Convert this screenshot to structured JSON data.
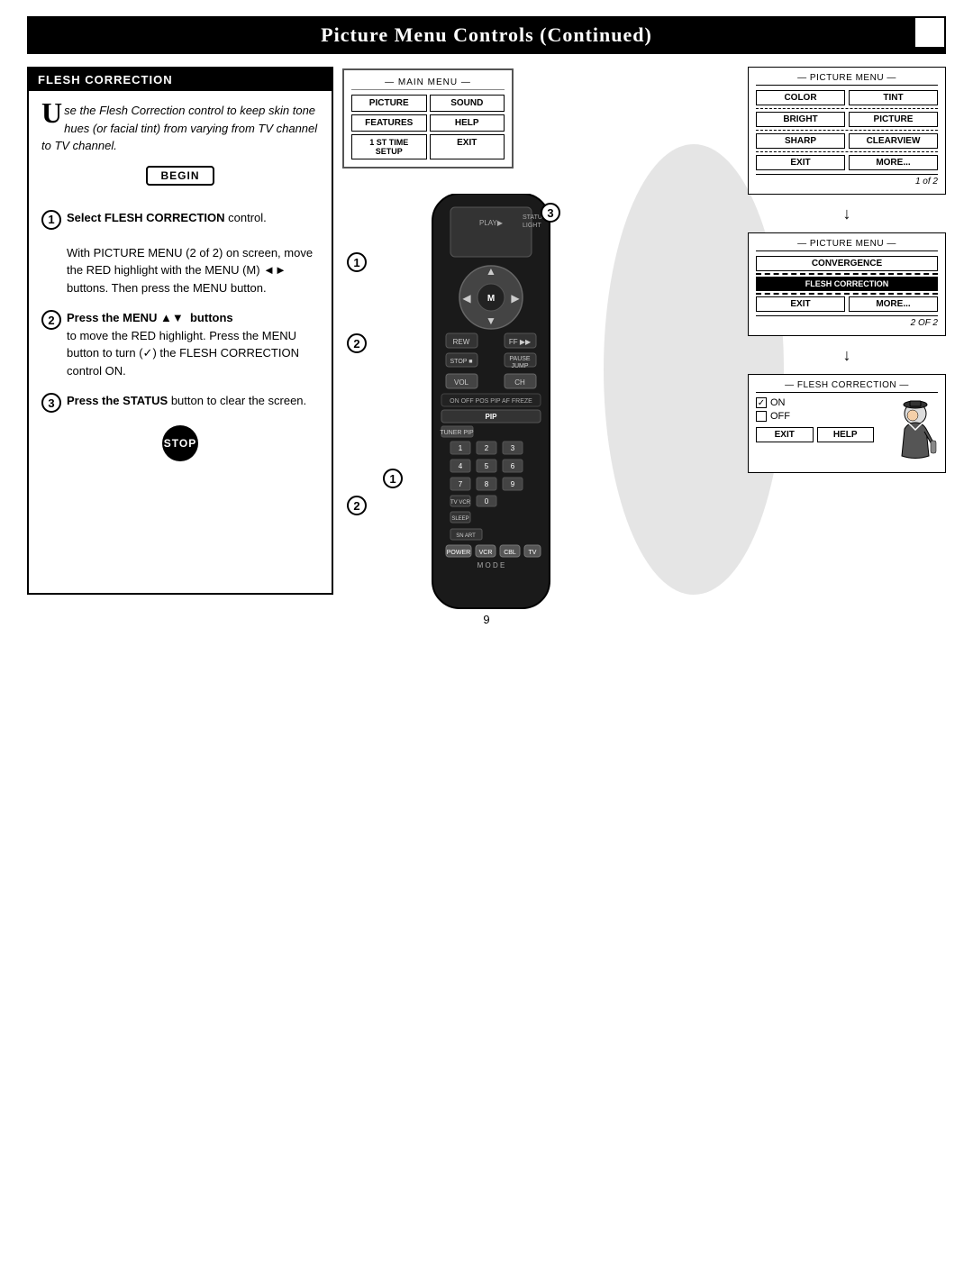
{
  "header": {
    "title": "Picture Menu Controls (Continued)",
    "box": ""
  },
  "left_panel": {
    "title": "FLESH CORRECTION",
    "intro": {
      "drop_cap": "U",
      "text": "se the  Flesh Correction control to keep skin tone hues (or facial tint) from varying from TV channel to TV channel."
    },
    "begin_label": "BEGIN",
    "steps": [
      {
        "num": "1",
        "text_parts": [
          {
            "bold": true,
            "text": "Select FLESH CORRECTION"
          },
          {
            "bold": false,
            "text": " control."
          },
          {
            "bold": false,
            "text": "\n\nWith PICTURE MENU (2 of 2) on screen, move the RED highlight with the MENU (M) "
          },
          {
            "bold": false,
            "text": " buttons. Then press the MENU button."
          }
        ]
      },
      {
        "num": "2",
        "text_parts": [
          {
            "bold": true,
            "text": "Press the MENU ▲▼  buttons"
          },
          {
            "bold": false,
            "text": "\nto move the RED highlight. Press the MENU button to turn (✓) the FLESH CORRECTION control ON."
          }
        ]
      },
      {
        "num": "3",
        "text_parts": [
          {
            "bold": true,
            "text": "Press the STATUS"
          },
          {
            "bold": false,
            "text": " button to clear the screen."
          }
        ]
      }
    ],
    "stop_label": "STOP"
  },
  "main_menu_screen": {
    "title": "MAIN MENU",
    "buttons": [
      {
        "label": "PICTURE",
        "col": 1,
        "row": 1
      },
      {
        "label": "SOUND",
        "col": 2,
        "row": 1
      },
      {
        "label": "FEATURES",
        "col": 1,
        "row": 2
      },
      {
        "label": "HELP",
        "col": 2,
        "row": 2
      },
      {
        "label": "1 ST TIME SETUP",
        "col": 1,
        "row": 3
      },
      {
        "label": "EXIT",
        "col": 2,
        "row": 3
      }
    ]
  },
  "picture_menu_1": {
    "title": "PICTURE MENU",
    "buttons_row1": [
      "COLOR",
      "TINT"
    ],
    "buttons_row2": [
      "BRIGHT",
      "PICTURE"
    ],
    "buttons_row3": [
      "SHARP",
      "CLEARVIEW"
    ],
    "buttons_row4": [
      "EXIT",
      "MORE..."
    ],
    "page": "1 of 2"
  },
  "picture_menu_2": {
    "title": "PICTURE MENU",
    "buttons_row1": [
      "CONVERGENCE"
    ],
    "buttons_row2": [
      "FLESH CORRECTION"
    ],
    "buttons_row3": [
      "EXIT",
      "MORE..."
    ],
    "page": "2 OF 2"
  },
  "flesh_correction_screen": {
    "title": "FLESH CORRECTION",
    "on_label": "ON",
    "off_label": "OFF",
    "on_checked": true,
    "off_checked": false,
    "buttons": [
      "EXIT",
      "HELP"
    ]
  },
  "diagram": {
    "step_labels": [
      "1",
      "2",
      "3"
    ],
    "step2_label2": "2"
  },
  "page_number": "9"
}
